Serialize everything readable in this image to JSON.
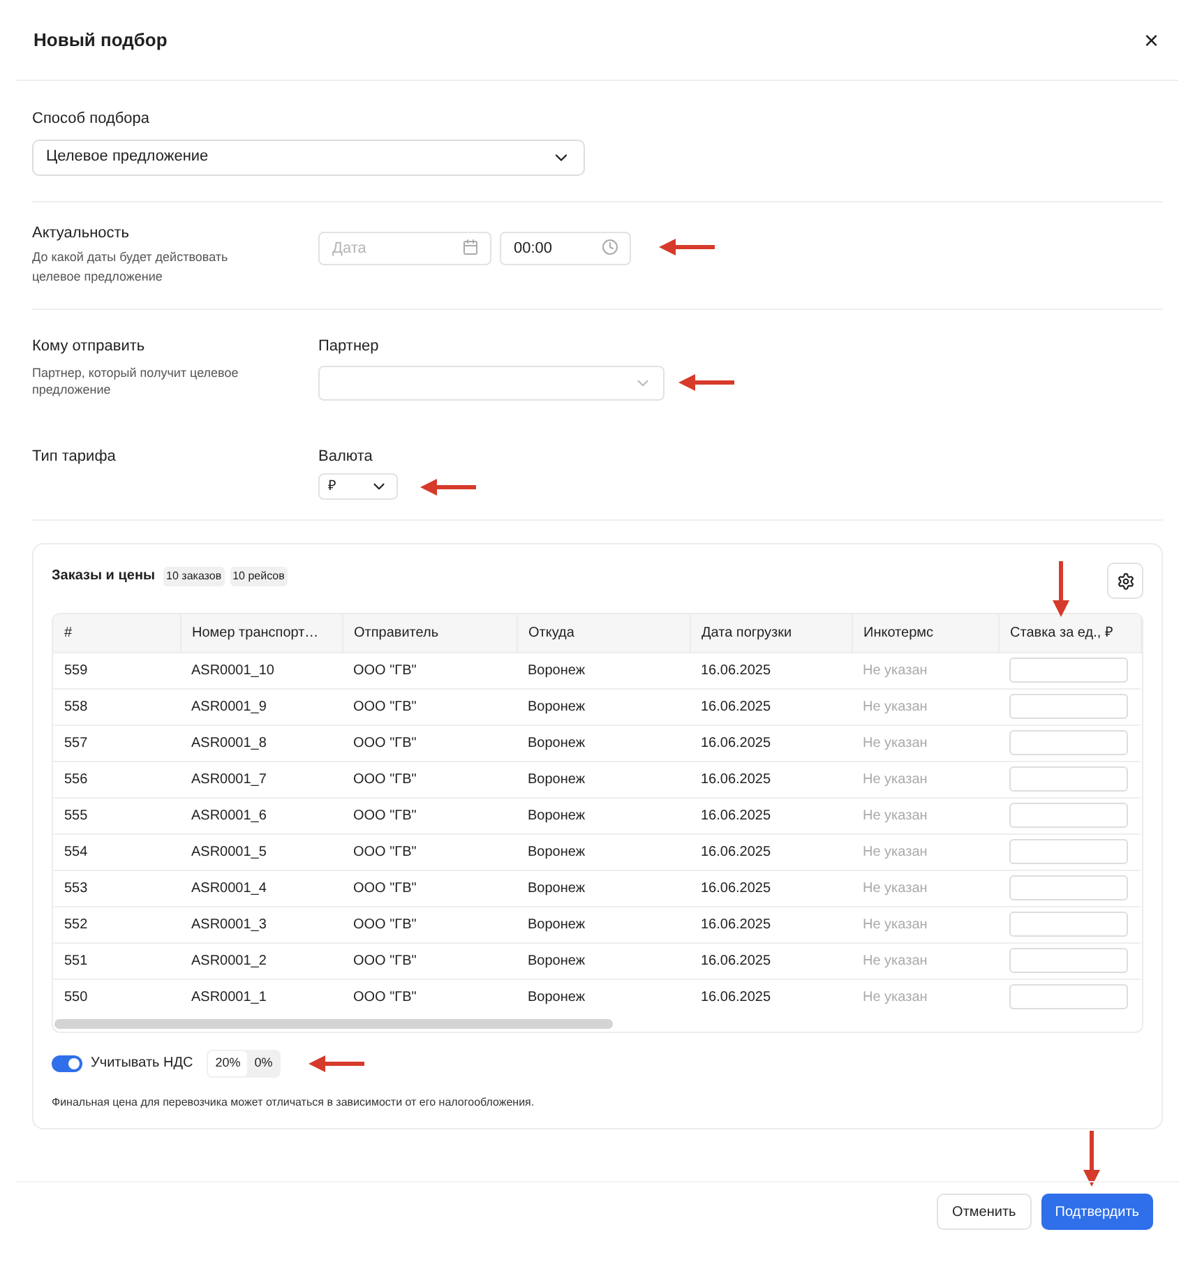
{
  "dialog": {
    "title": "Новый подбор",
    "close": "×"
  },
  "method": {
    "label": "Способ подбора",
    "value": "Целевое предложение"
  },
  "relevance": {
    "title": "Актуальность",
    "hint": "До какой даты будет действовать целевое предложение",
    "date_placeholder": "Дата",
    "time_value": "00:00"
  },
  "recipient": {
    "title": "Кому отправить",
    "hint": "Партнер, который получит целевое предложение",
    "field_label": "Партнер"
  },
  "tariff": {
    "title": "Тип тарифа",
    "field_label": "Валюта",
    "currency": "₽"
  },
  "orders": {
    "title": "Заказы и цены",
    "badges": [
      "10 заказов",
      "10 рейсов"
    ],
    "columns": [
      "#",
      "Номер транспорт…",
      "Отправитель",
      "Откуда",
      "Дата погрузки",
      "Инкотермс",
      "Ставка за ед., ₽"
    ],
    "rows": [
      {
        "id": "559",
        "number": "ASR0001_10",
        "sender": "ООО \"ГВ\"",
        "from": "Воронеж",
        "date": "16.06.2025",
        "incoterms": "Не указан"
      },
      {
        "id": "558",
        "number": "ASR0001_9",
        "sender": "ООО \"ГВ\"",
        "from": "Воронеж",
        "date": "16.06.2025",
        "incoterms": "Не указан"
      },
      {
        "id": "557",
        "number": "ASR0001_8",
        "sender": "ООО \"ГВ\"",
        "from": "Воронеж",
        "date": "16.06.2025",
        "incoterms": "Не указан"
      },
      {
        "id": "556",
        "number": "ASR0001_7",
        "sender": "ООО \"ГВ\"",
        "from": "Воронеж",
        "date": "16.06.2025",
        "incoterms": "Не указан"
      },
      {
        "id": "555",
        "number": "ASR0001_6",
        "sender": "ООО \"ГВ\"",
        "from": "Воронеж",
        "date": "16.06.2025",
        "incoterms": "Не указан"
      },
      {
        "id": "554",
        "number": "ASR0001_5",
        "sender": "ООО \"ГВ\"",
        "from": "Воронеж",
        "date": "16.06.2025",
        "incoterms": "Не указан"
      },
      {
        "id": "553",
        "number": "ASR0001_4",
        "sender": "ООО \"ГВ\"",
        "from": "Воронеж",
        "date": "16.06.2025",
        "incoterms": "Не указан"
      },
      {
        "id": "552",
        "number": "ASR0001_3",
        "sender": "ООО \"ГВ\"",
        "from": "Воронеж",
        "date": "16.06.2025",
        "incoterms": "Не указан"
      },
      {
        "id": "551",
        "number": "ASR0001_2",
        "sender": "ООО \"ГВ\"",
        "from": "Воронеж",
        "date": "16.06.2025",
        "incoterms": "Не указан"
      },
      {
        "id": "550",
        "number": "ASR0001_1",
        "sender": "ООО \"ГВ\"",
        "from": "Воронеж",
        "date": "16.06.2025",
        "incoterms": "Не указан"
      }
    ],
    "vat": {
      "label": "Учитывать НДС",
      "on": true,
      "options": [
        {
          "label": "20%",
          "selected": true
        },
        {
          "label": "0%",
          "selected": false
        }
      ]
    },
    "note": "Финальная цена для перевозчика может отличаться в зависимости от его налогообложения."
  },
  "buttons": [
    {
      "label": "Отменить",
      "kind": "secondary"
    },
    {
      "label": "Подтвердить",
      "kind": "primary"
    }
  ]
}
